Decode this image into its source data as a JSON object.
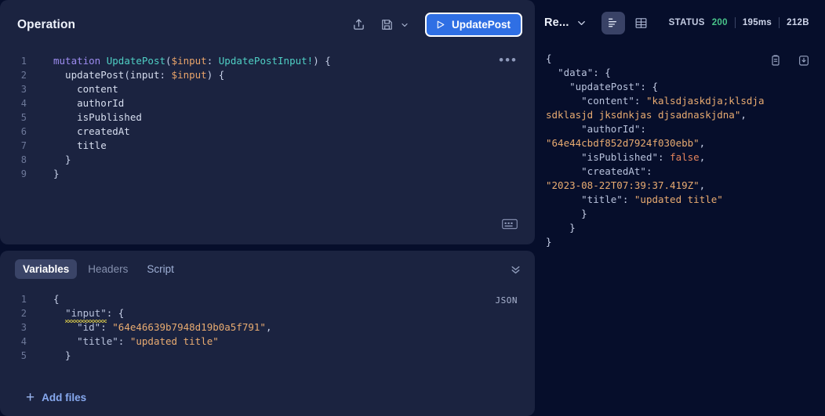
{
  "operation": {
    "title": "Operation",
    "actions": {
      "share_icon": "share-upload-icon",
      "save_icon": "save-floppy-icon",
      "save_dropdown_icon": "chevron-down-icon",
      "more_icon": "ellipsis-icon",
      "keyboard_icon": "keyboard-icon"
    },
    "run_button": {
      "label": "UpdatePost",
      "icon": "play-icon",
      "bg_color": "#2f6fe4",
      "border_color": "#ffffff"
    },
    "code_lines": [
      {
        "n": "1",
        "indent": 0,
        "tokens": [
          {
            "t": "mutation",
            "c": "tok-kw"
          },
          {
            "t": " ",
            "c": "tok-punc"
          },
          {
            "t": "UpdatePost",
            "c": "tok-type"
          },
          {
            "t": "(",
            "c": "tok-punc"
          },
          {
            "t": "$input",
            "c": "tok-var"
          },
          {
            "t": ": ",
            "c": "tok-punc"
          },
          {
            "t": "UpdatePostInput!",
            "c": "tok-type"
          },
          {
            "t": ") {",
            "c": "tok-punc"
          }
        ]
      },
      {
        "n": "2",
        "indent": 1,
        "tokens": [
          {
            "t": "  updatePost",
            "c": "tok-field"
          },
          {
            "t": "(",
            "c": "tok-punc"
          },
          {
            "t": "input",
            "c": "tok-field"
          },
          {
            "t": ": ",
            "c": "tok-punc"
          },
          {
            "t": "$input",
            "c": "tok-var"
          },
          {
            "t": ") {",
            "c": "tok-punc"
          }
        ]
      },
      {
        "n": "3",
        "indent": 2,
        "tokens": [
          {
            "t": "    content",
            "c": "tok-field"
          }
        ]
      },
      {
        "n": "4",
        "indent": 2,
        "tokens": [
          {
            "t": "    authorId",
            "c": "tok-field"
          }
        ]
      },
      {
        "n": "5",
        "indent": 2,
        "tokens": [
          {
            "t": "    isPublished",
            "c": "tok-field"
          }
        ]
      },
      {
        "n": "6",
        "indent": 2,
        "tokens": [
          {
            "t": "    createdAt",
            "c": "tok-field"
          }
        ]
      },
      {
        "n": "7",
        "indent": 2,
        "tokens": [
          {
            "t": "    title",
            "c": "tok-field"
          }
        ]
      },
      {
        "n": "8",
        "indent": 1,
        "tokens": [
          {
            "t": "  }",
            "c": "tok-punc"
          }
        ]
      },
      {
        "n": "9",
        "indent": 0,
        "tokens": [
          {
            "t": "}",
            "c": "tok-punc"
          }
        ]
      }
    ]
  },
  "variables": {
    "tabs": [
      {
        "label": "Variables",
        "active": true
      },
      {
        "label": "Headers",
        "active": false
      },
      {
        "label": "Script",
        "active": false
      }
    ],
    "collapse_icon": "chevrons-down-icon",
    "format_badge": "JSON",
    "code_lines": [
      {
        "n": "1",
        "tokens": [
          {
            "t": "{",
            "c": "tok-punc"
          }
        ]
      },
      {
        "n": "2",
        "tokens": [
          {
            "t": "  ",
            "c": "tok-punc"
          },
          {
            "t": "\"input\"",
            "c": "tok-key",
            "squiggle": true
          },
          {
            "t": ": {",
            "c": "tok-punc"
          }
        ]
      },
      {
        "n": "3",
        "tokens": [
          {
            "t": "    ",
            "c": "tok-punc"
          },
          {
            "t": "\"id\"",
            "c": "tok-key"
          },
          {
            "t": ": ",
            "c": "tok-punc"
          },
          {
            "t": "\"64e46639b7948d19b0a5f791\"",
            "c": "tok-str"
          },
          {
            "t": ",",
            "c": "tok-punc"
          }
        ]
      },
      {
        "n": "4",
        "tokens": [
          {
            "t": "    ",
            "c": "tok-punc"
          },
          {
            "t": "\"title\"",
            "c": "tok-key"
          },
          {
            "t": ": ",
            "c": "tok-punc"
          },
          {
            "t": "\"updated title\"",
            "c": "tok-str"
          }
        ]
      },
      {
        "n": "5",
        "tokens": [
          {
            "t": "  }",
            "c": "tok-punc"
          }
        ]
      }
    ],
    "add_files_label": "Add files",
    "add_files_icon": "plus-icon"
  },
  "response": {
    "title": "Re...",
    "title_chevron_icon": "chevron-down-icon",
    "view_buttons": [
      {
        "name": "tree-view-button",
        "icon": "lines-list-icon",
        "active": true
      },
      {
        "name": "table-view-button",
        "icon": "table-grid-icon",
        "active": false
      }
    ],
    "status_label": "STATUS",
    "status_code": "200",
    "status_code_color": "#49c48a",
    "time": "195ms",
    "size": "212B",
    "copy_icon": "clipboard-copy-icon",
    "download_icon": "download-icon",
    "body_lines": [
      {
        "tokens": [
          {
            "t": "{",
            "c": "tok-punc"
          }
        ]
      },
      {
        "tokens": [
          {
            "t": "  ",
            "c": "tok-punc"
          },
          {
            "t": "\"data\"",
            "c": "tok-key"
          },
          {
            "t": ": {",
            "c": "tok-punc"
          }
        ]
      },
      {
        "tokens": [
          {
            "t": "    ",
            "c": "tok-punc"
          },
          {
            "t": "\"updatePost\"",
            "c": "tok-key"
          },
          {
            "t": ": {",
            "c": "tok-punc"
          }
        ]
      },
      {
        "tokens": [
          {
            "t": "      ",
            "c": "tok-punc"
          },
          {
            "t": "\"content\"",
            "c": "tok-key"
          },
          {
            "t": ": ",
            "c": "tok-punc"
          },
          {
            "t": "\"kalsdjaskdja;klsdja",
            "c": "tok-str"
          }
        ]
      },
      {
        "tokens": [
          {
            "t": "sdklasjd jksdnkjas djsadnaskjdna\"",
            "c": "tok-str"
          },
          {
            "t": ",",
            "c": "tok-punc"
          }
        ]
      },
      {
        "tokens": [
          {
            "t": "      ",
            "c": "tok-punc"
          },
          {
            "t": "\"authorId\"",
            "c": "tok-key"
          },
          {
            "t": ":",
            "c": "tok-punc"
          }
        ]
      },
      {
        "tokens": [
          {
            "t": "\"64e44cbdf852d7924f030ebb\"",
            "c": "tok-str"
          },
          {
            "t": ",",
            "c": "tok-punc"
          }
        ]
      },
      {
        "tokens": [
          {
            "t": "      ",
            "c": "tok-punc"
          },
          {
            "t": "\"isPublished\"",
            "c": "tok-key"
          },
          {
            "t": ": ",
            "c": "tok-punc"
          },
          {
            "t": "false",
            "c": "tok-bool"
          },
          {
            "t": ",",
            "c": "tok-punc"
          }
        ]
      },
      {
        "tokens": [
          {
            "t": "      ",
            "c": "tok-punc"
          },
          {
            "t": "\"createdAt\"",
            "c": "tok-key"
          },
          {
            "t": ":",
            "c": "tok-punc"
          }
        ]
      },
      {
        "tokens": [
          {
            "t": "\"2023-08-22T07:39:37.419Z\"",
            "c": "tok-str"
          },
          {
            "t": ",",
            "c": "tok-punc"
          }
        ]
      },
      {
        "tokens": [
          {
            "t": "      ",
            "c": "tok-punc"
          },
          {
            "t": "\"title\"",
            "c": "tok-key"
          },
          {
            "t": ": ",
            "c": "tok-punc"
          },
          {
            "t": "\"updated title\"",
            "c": "tok-str"
          }
        ]
      },
      {
        "tokens": [
          {
            "t": "      }",
            "c": "tok-punc"
          }
        ]
      },
      {
        "tokens": [
          {
            "t": "    }",
            "c": "tok-punc"
          }
        ]
      },
      {
        "tokens": [
          {
            "t": "}",
            "c": "tok-punc"
          }
        ]
      }
    ]
  },
  "theme": {
    "page_bg": "#060e2b",
    "panel_bg": "#1b2340",
    "accent": "#2f6fe4",
    "link": "#87a9ef"
  }
}
